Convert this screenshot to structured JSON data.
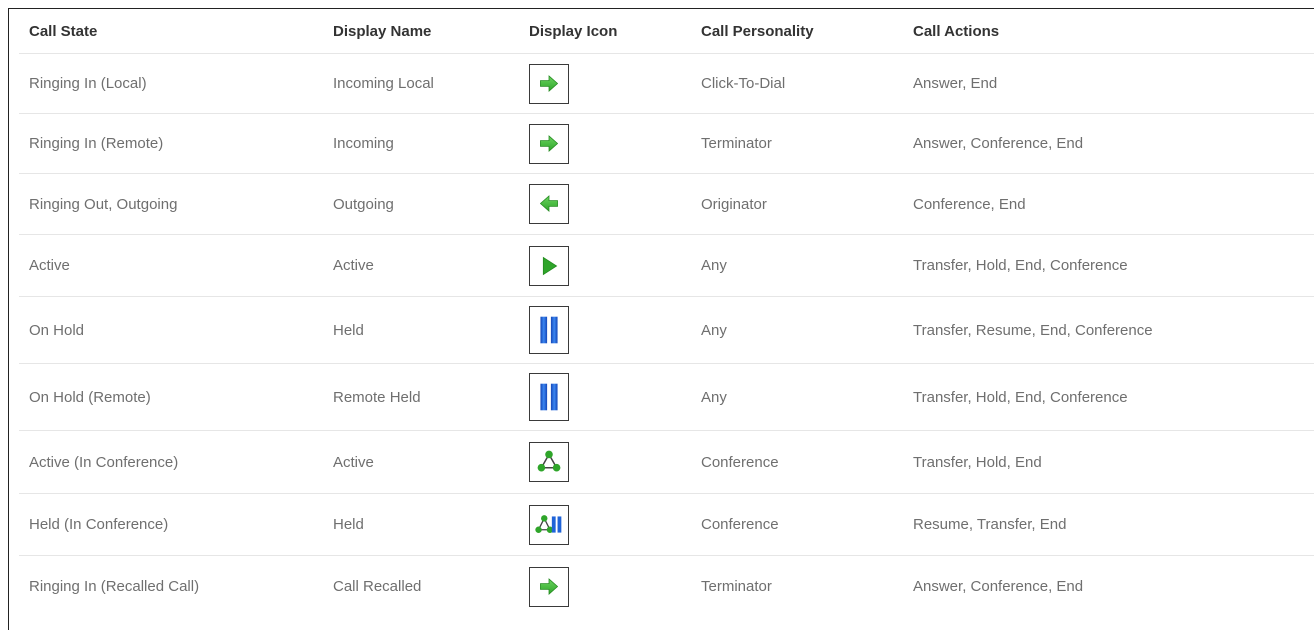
{
  "headers": {
    "call_state": "Call State",
    "display_name": "Display Name",
    "display_icon": "Display Icon",
    "call_personality": "Call Personality",
    "call_actions": "Call Actions"
  },
  "rows": [
    {
      "call_state": "Ringing In (Local)",
      "display_name": "Incoming Local",
      "icon": "arrow-right-icon",
      "call_personality": "Click-To-Dial",
      "call_actions": "Answer, End"
    },
    {
      "call_state": "Ringing In (Remote)",
      "display_name": "Incoming",
      "icon": "arrow-right-icon",
      "call_personality": "Terminator",
      "call_actions": "Answer, Conference, End"
    },
    {
      "call_state": "Ringing Out, Outgoing",
      "display_name": "Outgoing",
      "icon": "arrow-left-icon",
      "call_personality": "Originator",
      "call_actions": "Conference, End"
    },
    {
      "call_state": "Active",
      "display_name": "Active",
      "icon": "play-icon",
      "call_personality": "Any",
      "call_actions": "Transfer, Hold, End, Conference"
    },
    {
      "call_state": "On Hold",
      "display_name": "Held",
      "icon": "pause-icon",
      "call_personality": "Any",
      "call_actions": "Transfer, Resume, End, Conference"
    },
    {
      "call_state": "On Hold (Remote)",
      "display_name": "Remote Held",
      "icon": "pause-icon",
      "call_personality": "Any",
      "call_actions": "Transfer, Hold, End, Conference"
    },
    {
      "call_state": "Active (In Conference)",
      "display_name": "Active",
      "icon": "conference-icon",
      "call_personality": "Conference",
      "call_actions": "Transfer, Hold, End"
    },
    {
      "call_state": "Held (In Conference)",
      "display_name": "Held",
      "icon": "conference-held-icon",
      "call_personality": "Conference",
      "call_actions": "Resume, Transfer, End"
    },
    {
      "call_state": "Ringing In (Recalled Call)",
      "display_name": "Call Recalled",
      "icon": "arrow-right-icon",
      "call_personality": "Terminator",
      "call_actions": "Answer, Conference, End"
    }
  ],
  "colors": {
    "icon_green": "#2fa52a",
    "icon_blue": "#1f63d8",
    "header_text": "#333333",
    "cell_text": "#6f6f6f",
    "row_border": "#e6e6e6"
  }
}
